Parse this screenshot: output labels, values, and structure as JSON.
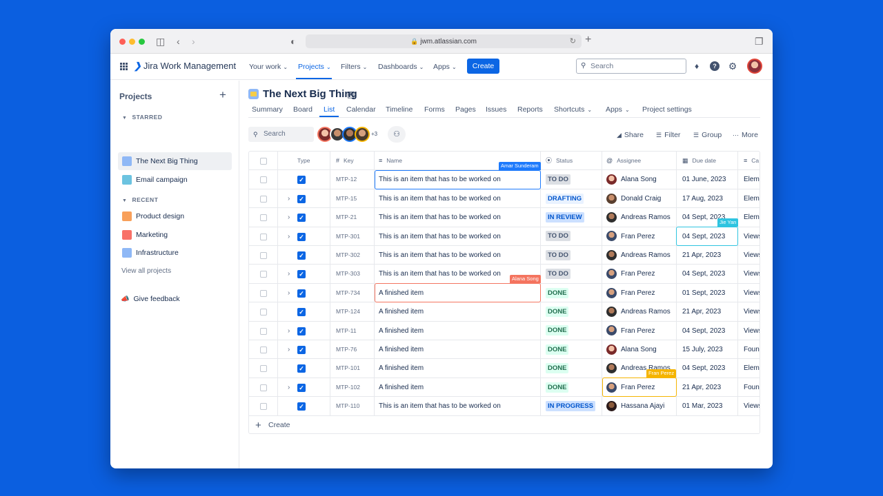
{
  "browser": {
    "url": "jwm.atlassian.com"
  },
  "topnav": {
    "logo": "Jira Work Management",
    "items": [
      {
        "label": "Your work"
      },
      {
        "label": "Projects"
      },
      {
        "label": "Filters"
      },
      {
        "label": "Dashboards"
      },
      {
        "label": "Apps"
      }
    ],
    "create_label": "Create",
    "search_placeholder": "Search"
  },
  "sidebar": {
    "title": "Projects",
    "starred_label": "STARRED",
    "starred": [
      {
        "label": "The Next Big Thing",
        "selected": true,
        "color": "#8fb8f6"
      },
      {
        "label": "Email campaign",
        "selected": false,
        "color": "#6cc3e0"
      }
    ],
    "recent_label": "RECENT",
    "recent": [
      {
        "label": "Product design",
        "color": "#f8a05a"
      },
      {
        "label": "Marketing",
        "color": "#f87168"
      },
      {
        "label": "Infrastructure",
        "color": "#8fb8f6"
      }
    ],
    "view_all": "View all projects",
    "feedback": "Give feedback"
  },
  "project": {
    "title": "The Next Big Thing",
    "tabs": [
      {
        "label": "Summary"
      },
      {
        "label": "Board"
      },
      {
        "label": "List"
      },
      {
        "label": "Calendar"
      },
      {
        "label": "Timeline"
      },
      {
        "label": "Forms"
      },
      {
        "label": "Pages"
      },
      {
        "label": "Issues"
      },
      {
        "label": "Reports"
      },
      {
        "label": "Shortcuts"
      },
      {
        "label": "Apps"
      },
      {
        "label": "Project settings"
      }
    ]
  },
  "toolbar": {
    "search_placeholder": "Search",
    "avatar_more": "+3",
    "share": "Share",
    "filter": "Filter",
    "group": "Group",
    "more": "More"
  },
  "table": {
    "headers": {
      "type": "Type",
      "key": "Key",
      "name": "Name",
      "status": "Status",
      "assignee": "Assignee",
      "due": "Due date",
      "category": "Ca"
    },
    "rows": [
      {
        "key": "MTP-12",
        "name": "This is an item that has to be worked on",
        "status": "TO DO",
        "assignee": "Alana Song",
        "due": "01 June, 2023",
        "category": "Eleme",
        "expandable": false
      },
      {
        "key": "MTP-15",
        "name": "This is an item that has to be worked on",
        "status": "DRAFTING",
        "assignee": "Donald Craig",
        "due": "17 Aug, 2023",
        "category": "Eleme",
        "expandable": true
      },
      {
        "key": "MTP-21",
        "name": "This is an item that has to be worked on",
        "status": "IN REVIEW",
        "assignee": "Andreas Ramos",
        "due": "04 Sept, 2023",
        "category": "Eleme",
        "expandable": true
      },
      {
        "key": "MTP-301",
        "name": "This is an item that has to be worked on",
        "status": "TO DO",
        "assignee": "Fran Perez",
        "due": "04 Sept, 2023",
        "category": "Views",
        "expandable": true
      },
      {
        "key": "MTP-302",
        "name": "This is an item that has to be worked on",
        "status": "TO DO",
        "assignee": "Andreas Ramos",
        "due": "21 Apr, 2023",
        "category": "Views",
        "expandable": false
      },
      {
        "key": "MTP-303",
        "name": "This is an item that has to be worked on",
        "status": "TO DO",
        "assignee": "Fran Perez",
        "due": "04 Sept, 2023",
        "category": "Views",
        "expandable": true
      },
      {
        "key": "MTP-734",
        "name": "A finished item",
        "status": "DONE",
        "assignee": "Fran Perez",
        "due": "01 Sept, 2023",
        "category": "Views",
        "expandable": true
      },
      {
        "key": "MTP-124",
        "name": "A finished item",
        "status": "DONE",
        "assignee": "Andreas Ramos",
        "due": "21 Apr, 2023",
        "category": "Views",
        "expandable": false
      },
      {
        "key": "MTP-11",
        "name": "A finished item",
        "status": "DONE",
        "assignee": "Fran Perez",
        "due": "04 Sept, 2023",
        "category": "Views",
        "expandable": true
      },
      {
        "key": "MTP-76",
        "name": "A finished item",
        "status": "DONE",
        "assignee": "Alana Song",
        "due": "15 July, 2023",
        "category": "Found",
        "expandable": true
      },
      {
        "key": "MTP-101",
        "name": "A finished item",
        "status": "DONE",
        "assignee": "Andreas Ramos",
        "due": "04 Sept, 2023",
        "category": "Eleme",
        "expandable": false
      },
      {
        "key": "MTP-102",
        "name": "A finished item",
        "status": "DONE",
        "assignee": "Fran Perez",
        "due": "21 Apr, 2023",
        "category": "Found",
        "expandable": true
      },
      {
        "key": "MTP-110",
        "name": "This is an item that has to be worked on",
        "status": "IN PROGRESS",
        "assignee": "Hassana Ajayi",
        "due": "01 Mar, 2023",
        "category": "Views",
        "expandable": false
      }
    ],
    "create_label": "Create"
  },
  "collaborators": [
    {
      "name": "Amar Sunderam",
      "color": "#1d7afc"
    },
    {
      "name": "Jie Yan",
      "color": "#2ec4e0"
    },
    {
      "name": "Alana Song",
      "color": "#f4745f"
    },
    {
      "name": "Fran Perez",
      "color": "#f5b400"
    }
  ]
}
